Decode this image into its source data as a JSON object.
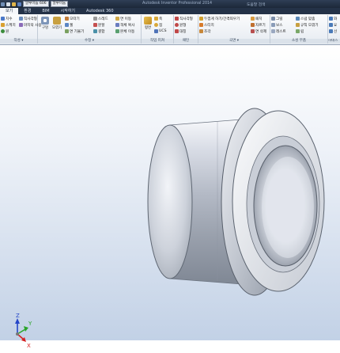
{
  "window": {
    "app_title": "Autodesk Inventor Professional 2014",
    "search_title": "도움말 검색"
  },
  "quick_access": {
    "material": "알루미늄 606",
    "appearance": "알루미늄"
  },
  "menu": [
    "보기",
    "환경",
    "BIM",
    "시작하기",
    "Autodesk 360"
  ],
  "ribbon": {
    "sketch": {
      "title": "작성",
      "items": [
        "치수",
        "스케치",
        "원",
        "직사각형",
        "마지막 사용"
      ],
      "group_label": "작성 ▾"
    },
    "edit": {
      "title": "수정",
      "items": [
        "구멍",
        "모깎기",
        "모따기",
        "쉘",
        "면 기울기",
        "스레드",
        "분할",
        "결합",
        "면 이동",
        "객체 복사",
        "본체 이동"
      ],
      "group_label": "수정 ▾"
    },
    "work": {
      "title": "작업 피쳐",
      "items": [
        "평면",
        "축",
        "점",
        "UCS"
      ],
      "group_label": "작업 피쳐"
    },
    "pattern": {
      "title": "패턴",
      "items": [
        "직사각형",
        "원형",
        "대칭"
      ],
      "group_label": "패턴"
    },
    "surface": {
      "title": "곡면",
      "items": [
        "두껍게 하기/간격띄우기",
        "스티치",
        "조각",
        "패치",
        "자르기",
        "면 삭제"
      ],
      "group_label": "곡면 ▾"
    },
    "plastic": {
      "title": "소성 부품",
      "items": [
        "그릴",
        "보스",
        "레스트",
        "스냅 맞춤",
        "규칙 모깎기",
        "립"
      ],
      "group_label": "소성 부품"
    },
    "harness": {
      "items": [
        "와",
        "요",
        "선"
      ],
      "group_label": "하네스"
    }
  },
  "triad": {
    "x": "X",
    "y": "Y",
    "z": "Z"
  },
  "colors": {
    "x_axis": "#d42020",
    "y_axis": "#2aa52a",
    "z_axis": "#2445c8"
  }
}
